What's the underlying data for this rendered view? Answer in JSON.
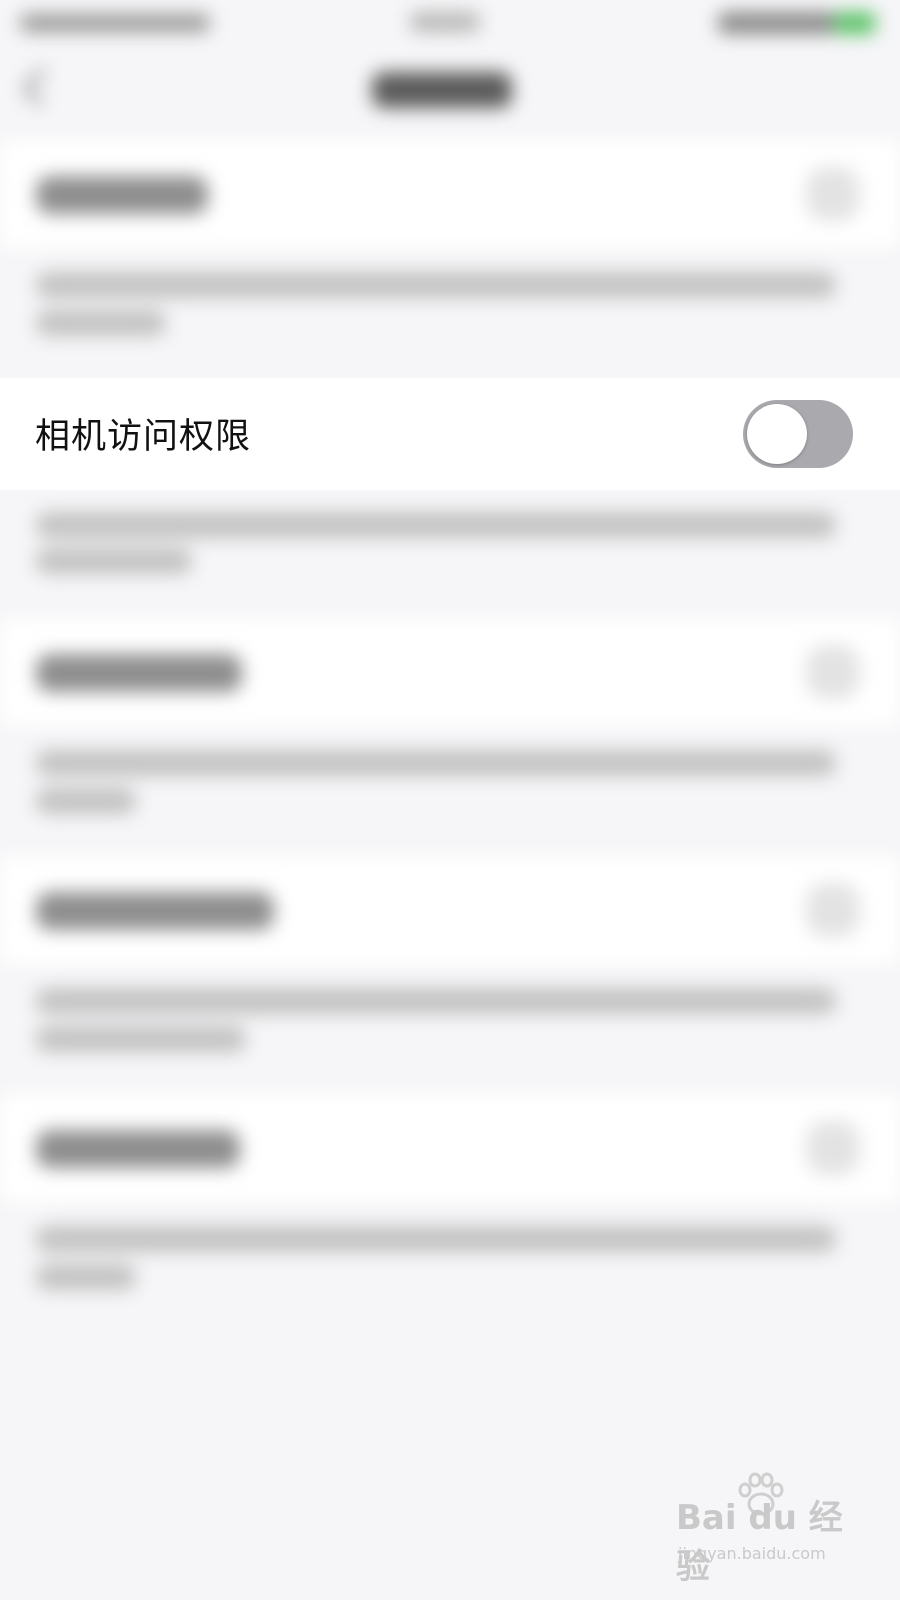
{
  "camera_permission": {
    "label": "相机访问权限",
    "enabled": false
  },
  "watermark": {
    "logo": "Bai du 经验",
    "url": "jingyan.baidu.com"
  },
  "colors": {
    "background": "#f6f6f8",
    "cell": "#ffffff",
    "toggle_off": "#a9a9ae",
    "battery": "#59c265"
  }
}
